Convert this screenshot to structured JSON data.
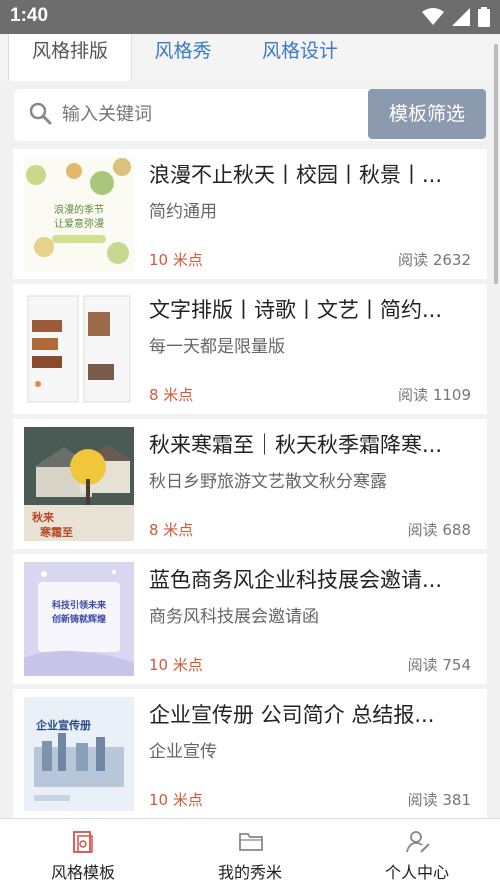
{
  "status": {
    "time": "1:40"
  },
  "tabs": [
    {
      "label": "风格排版"
    },
    {
      "label": "风格秀"
    },
    {
      "label": "风格设计"
    }
  ],
  "search": {
    "placeholder": "输入关键词",
    "filter_label": "模板筛选"
  },
  "items": [
    {
      "title": "浪漫不止秋天丨校园丨秋景丨...",
      "subtitle": "简约通用",
      "points": "10 米点",
      "reads": "阅读 2632",
      "thumb_text": [
        "浪漫的季节",
        "让爱意弥漫"
      ]
    },
    {
      "title": "文字排版丨诗歌丨文艺丨简约...",
      "subtitle": "每一天都是限量版",
      "points": "8 米点",
      "reads": "阅读 1109",
      "thumb_text": []
    },
    {
      "title": "秋来寒霜至｜秋天秋季霜降寒...",
      "subtitle": "秋日乡野旅游文艺散文秋分寒露",
      "points": "8 米点",
      "reads": "阅读 688",
      "thumb_text": [
        "秋来",
        "寒霜至"
      ]
    },
    {
      "title": "蓝色商务风企业科技展会邀请...",
      "subtitle": "商务风科技展会邀请函",
      "points": "10 米点",
      "reads": "阅读 754",
      "thumb_text": [
        "科技引领未来",
        "创新铸就辉煌"
      ]
    },
    {
      "title": "企业宣传册 公司简介 总结报...",
      "subtitle": "企业宣传",
      "points": "10 米点",
      "reads": "阅读 381",
      "thumb_text": [
        "企业宣传册"
      ]
    }
  ],
  "bottom_nav": [
    {
      "label": "风格模板"
    },
    {
      "label": "我的秀米"
    },
    {
      "label": "个人中心"
    }
  ]
}
